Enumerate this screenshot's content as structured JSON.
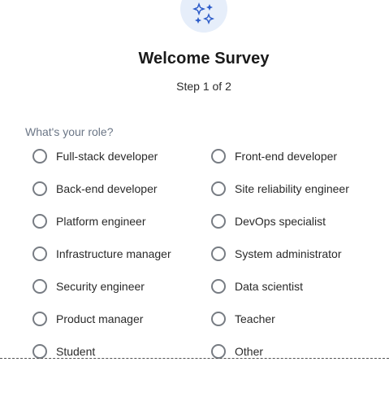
{
  "survey": {
    "icon": "sparkles-icon",
    "accent_color": "#2e5dc9",
    "title": "Welcome Survey",
    "step": "Step 1 of 2",
    "question": "What's your role?",
    "selected": null,
    "options_left": [
      "Full-stack developer",
      "Back-end developer",
      "Platform engineer",
      "Infrastructure manager",
      "Security engineer",
      "Product manager",
      "Student"
    ],
    "options_right": [
      "Front-end developer",
      "Site reliability engineer",
      "DevOps specialist",
      "System administrator",
      "Data scientist",
      "Teacher",
      "Other"
    ]
  }
}
